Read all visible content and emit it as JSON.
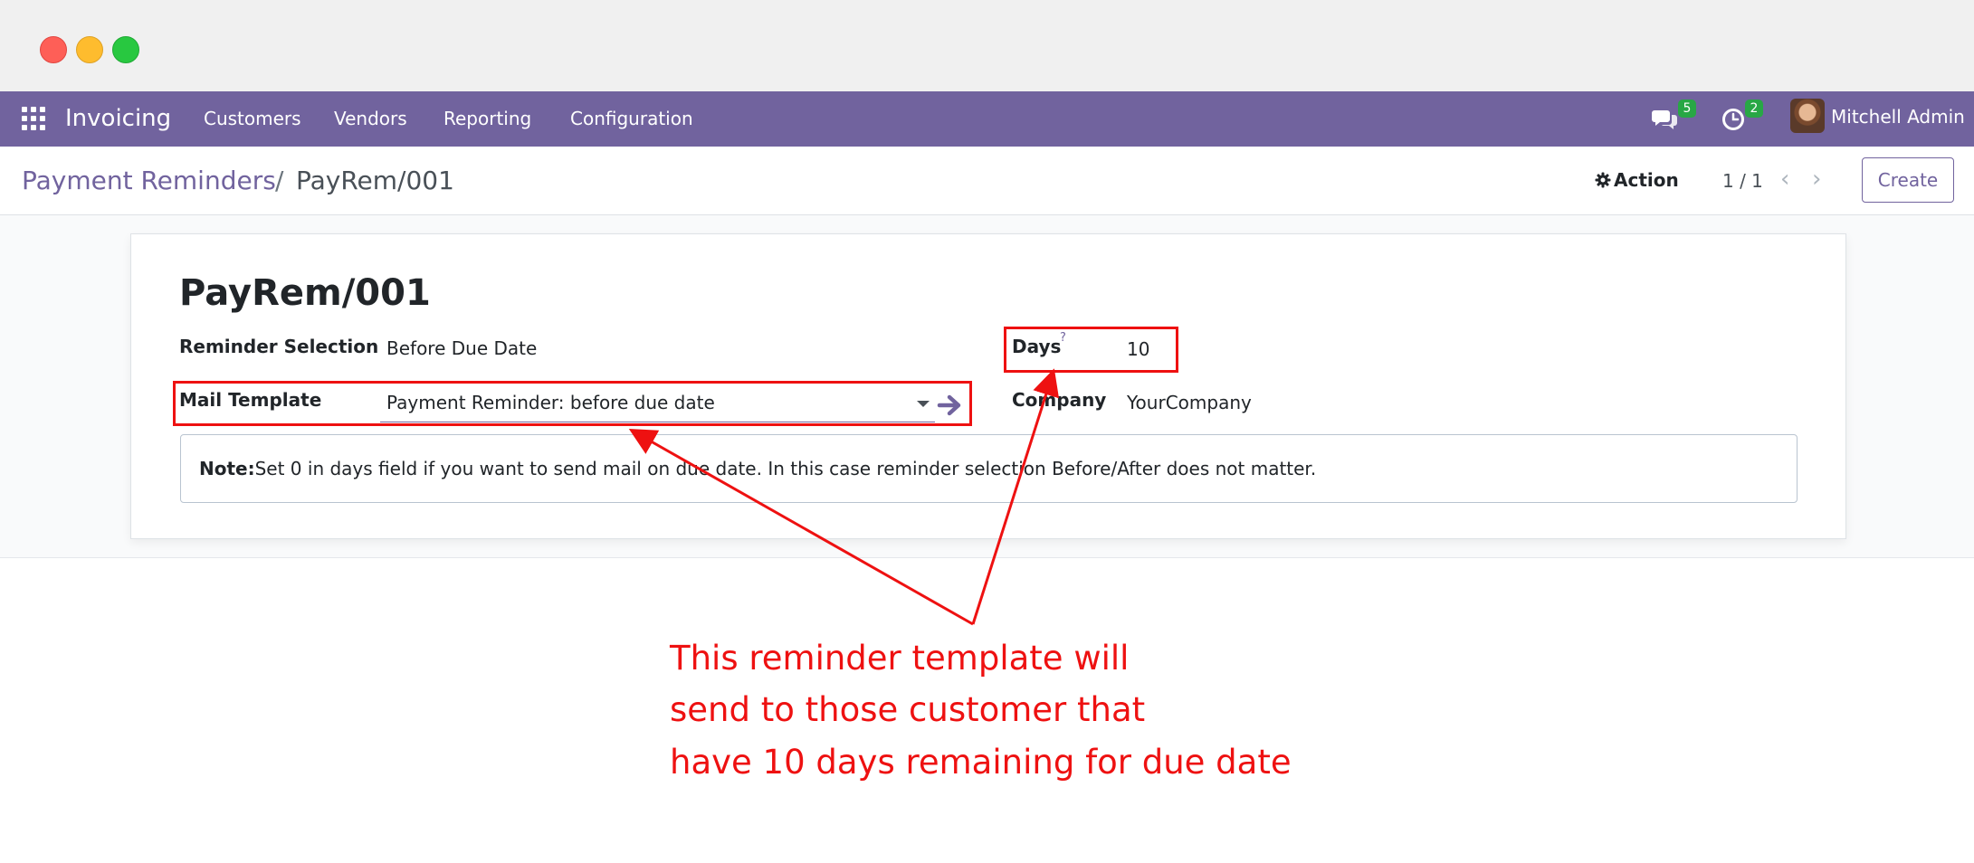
{
  "window": {
    "controls": [
      "close",
      "minimize",
      "zoom"
    ]
  },
  "navbar": {
    "app_name": "Invoicing",
    "menu": [
      "Customers",
      "Vendors",
      "Reporting",
      "Configuration"
    ],
    "messages_badge": "5",
    "activities_badge": "2",
    "user_name": "Mitchell Admin",
    "color": "#71639e"
  },
  "breadcrumb": {
    "parent": "Payment Reminders",
    "separator": "/",
    "current": "PayRem/001"
  },
  "toolbar": {
    "action_label": "Action",
    "pager_value": "1 / 1",
    "create_label": "Create"
  },
  "form": {
    "title": "PayRem/001",
    "reminder_selection": {
      "label": "Reminder Selection",
      "value": "Before Due Date"
    },
    "days": {
      "label": "Days",
      "help": "?",
      "value": "10"
    },
    "mail_template": {
      "label": "Mail Template",
      "value": "Payment Reminder: before due date"
    },
    "company": {
      "label": "Company",
      "value": "YourCompany"
    },
    "note": {
      "prefix": "Note:",
      "text": "Set 0 in days field if you want to send mail on due date. In this case reminder selection Before/After does not matter."
    }
  },
  "annotation": {
    "lines": [
      "This reminder template will",
      "send to those customer that",
      "have 10 days remaining for due date"
    ],
    "color": "#ee1111"
  }
}
